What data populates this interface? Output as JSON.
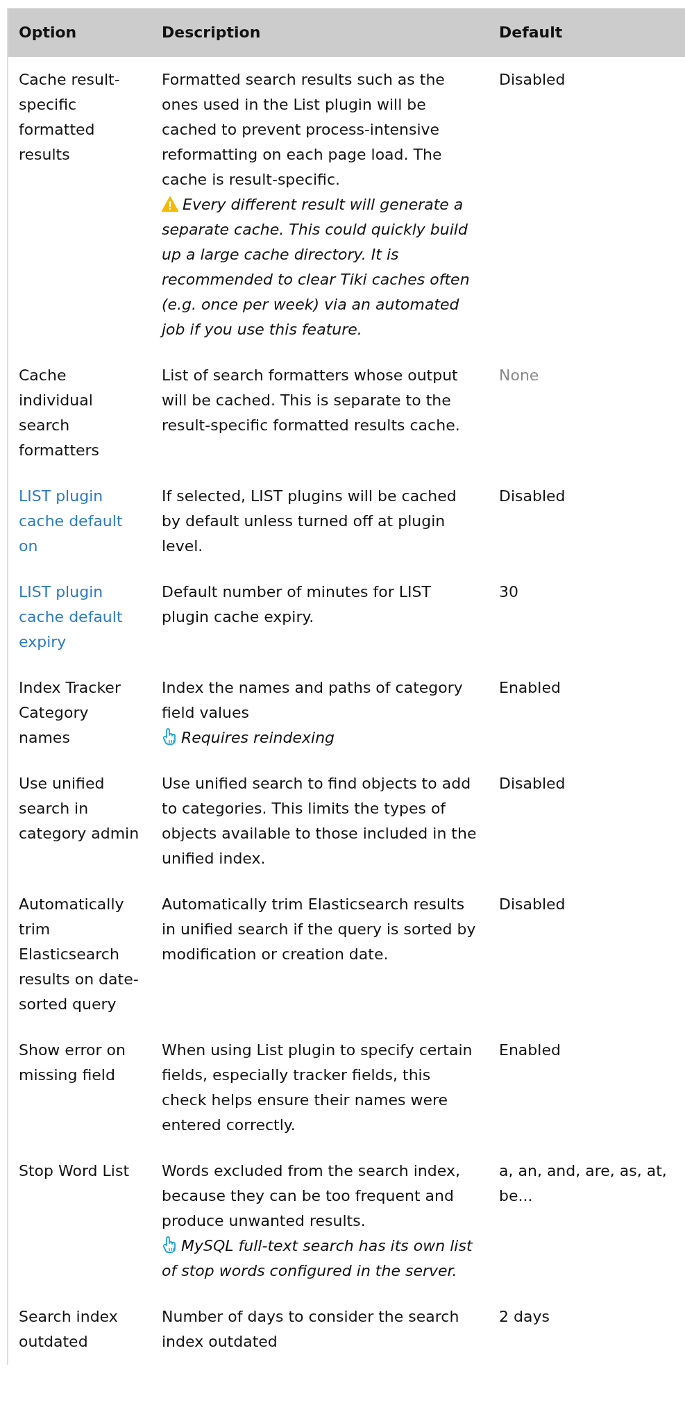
{
  "columns": [
    "Option",
    "Description",
    "Default"
  ],
  "rows": [
    {
      "option": "Cache result-specific formatted results",
      "option_link": false,
      "description": "Formatted search results such as the ones used in the List plugin will be cached to prevent process-intensive reformatting on each page load. The cache is result-specific.",
      "notes": [
        {
          "kind": "warning",
          "text": "Every different result will generate a separate cache. This could quickly build up a large cache directory. It is recommended to clear Tiki caches often (e.g. once per week) via an automated job if you use this feature."
        }
      ],
      "default": "Disabled",
      "default_muted": false
    },
    {
      "option": "Cache individual search formatters",
      "option_link": false,
      "description": "List of search formatters whose output will be cached. This is separate to the result-specific formatted results cache.",
      "notes": [],
      "default": "None",
      "default_muted": true
    },
    {
      "option": "LIST plugin cache default on",
      "option_link": true,
      "description": "If selected, LIST plugins will be cached by default unless turned off at plugin level.",
      "notes": [],
      "default": "Disabled",
      "default_muted": false
    },
    {
      "option": "LIST plugin cache default expiry",
      "option_link": true,
      "description": "Default number of minutes for LIST plugin cache expiry.",
      "notes": [],
      "default": "30",
      "default_muted": false
    },
    {
      "option": "Index Tracker Category names",
      "option_link": false,
      "description": "Index the names and paths of category field values",
      "notes": [
        {
          "kind": "tip",
          "text": "Requires reindexing"
        }
      ],
      "default": "Enabled",
      "default_muted": false
    },
    {
      "option": "Use unified search in category admin",
      "option_link": false,
      "description": "Use unified search to find objects to add to categories. This limits the types of objects available to those included in the unified index.",
      "notes": [],
      "default": "Disabled",
      "default_muted": false
    },
    {
      "option": "Automatically trim Elasticsearch results on date-sorted query",
      "option_link": false,
      "description": "Automatically trim Elasticsearch results in unified search if the query is sorted by modification or creation date.",
      "notes": [],
      "default": "Disabled",
      "default_muted": false
    },
    {
      "option": "Show error on missing field",
      "option_link": false,
      "description": "When using List plugin to specify certain fields, especially tracker fields, this check helps ensure their names were entered correctly.",
      "notes": [],
      "default": "Enabled",
      "default_muted": false
    },
    {
      "option": "Stop Word List",
      "option_link": false,
      "description": "Words excluded from the search index, because they can be too frequent and produce unwanted results.",
      "notes": [
        {
          "kind": "tip",
          "text": "MySQL full-text search has its own list of stop words configured in the server."
        }
      ],
      "default": "a, an, and, are, as, at, be...",
      "default_muted": false
    },
    {
      "option": "Search index outdated",
      "option_link": false,
      "description": "Number of days to consider the search index outdated",
      "notes": [],
      "default": "2 days",
      "default_muted": false
    }
  ]
}
